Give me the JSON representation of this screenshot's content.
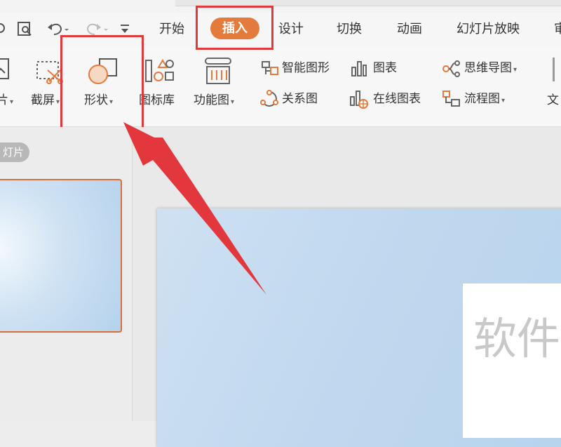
{
  "tabs": {
    "start": "开始",
    "insert": "插入",
    "design": "设计",
    "transition": "切换",
    "animation": "动画",
    "slideshow": "幻灯片放映",
    "partial": "审"
  },
  "ribbon": {
    "picture_partial": "片",
    "screenshot": "截屏",
    "shapes": "形状",
    "icon_library": "图标库",
    "function_chart": "功能图",
    "smart_art": "智能图形",
    "chart": "图表",
    "relationship": "关系图",
    "online_chart": "在线图表",
    "mind_map": "思维导图",
    "flowchart": "流程图",
    "text_partial": "文"
  },
  "left_pane": {
    "badge": "灯片"
  },
  "canvas": {
    "title_partial": "软件"
  },
  "colors": {
    "accent": "#e47a3c",
    "annotation": "#e0393e",
    "thumb_border": "#d5703c",
    "slide_blue": "#bcd5ee"
  },
  "icons": {
    "qa1": "scan-icon",
    "qa2": "preview-icon",
    "qa3": "undo-icon",
    "qa4": "redo-icon",
    "qa5": "customize-icon"
  }
}
